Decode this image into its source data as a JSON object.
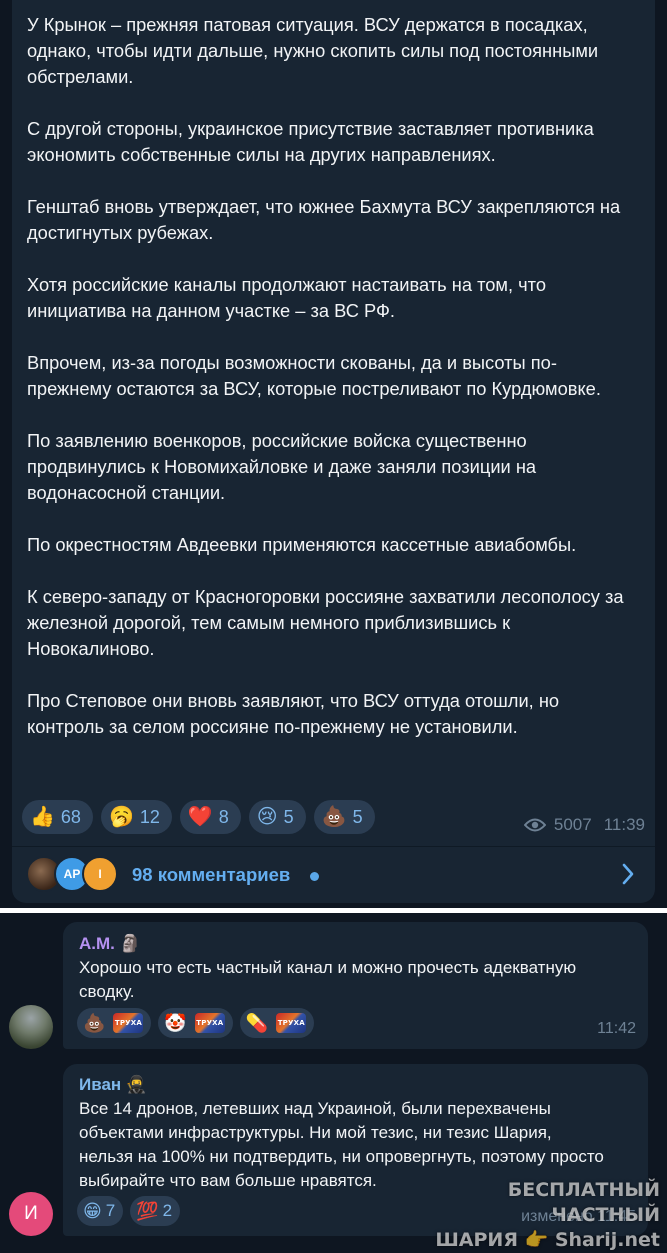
{
  "post": {
    "paragraphs": [
      "У Крынок – прежняя патовая ситуация. ВСУ держатся в посадках, однако, чтобы идти дальше, нужно скопить силы под постоянными обстрелами.",
      "С другой стороны, украинское присутствие заставляет противника экономить собственные силы на других направлениях.",
      "Генштаб вновь утверждает, что южнее Бахмута ВСУ закрепляются на достигнутых рубежах.",
      "Хотя российские каналы продолжают настаивать на том, что инициатива на данном участке – за ВС РФ.",
      "Впрочем, из-за погоды возможности скованы, да и высоты по-прежнему остаются за ВСУ, которые постреливают по Курдюмовке.",
      "По заявлению военкоров, российские войска существенно продвинулись к Новомихайловке и даже заняли позиции на водонасосной станции.",
      "По окрестностям Авдеевки применяются кассетные авиабомбы.",
      "К северо-западу от Красногоровки россияне захватили лесополосу за железной дорогой, тем самым немного приблизившись к Новокалиново.",
      "Про Степовое они вновь заявляют, что ВСУ оттуда отошли, но контроль за селом россияне по-прежнему не установили."
    ],
    "reactions": [
      {
        "emoji": "👍",
        "count": "68",
        "icon": "thumbs-up-icon"
      },
      {
        "emoji": "🥱",
        "count": "12",
        "icon": "yawning-face-icon"
      },
      {
        "emoji": "❤️",
        "count": "8",
        "icon": "heart-icon"
      },
      {
        "emoji": "😢",
        "count": "5",
        "icon": "crying-face-icon"
      },
      {
        "emoji": "💩",
        "count": "5",
        "icon": "pile-of-poo-icon"
      }
    ],
    "views": "5007",
    "time": "11:39"
  },
  "comments_bar": {
    "label": "98 комментариев",
    "avatars": [
      "",
      "AP",
      "I"
    ],
    "avatar_colors": [
      "#5a4030",
      "#3f9be6",
      "#f0a030"
    ]
  },
  "comments": [
    {
      "author": "А.М. 🗿",
      "author_color": "#b591f0",
      "text": "Хорошо что есть частный канал и можно прочесть адекватную сводку.",
      "time": "11:42",
      "reactions": [
        {
          "emoji": "💩",
          "badge": "ТРУХА",
          "icon": "pile-of-poo-icon"
        },
        {
          "emoji": "🤡",
          "badge": "ТРУХА",
          "icon": "clown-face-icon"
        },
        {
          "emoji": "💊",
          "badge": "ТРУХА",
          "icon": "pill-icon"
        }
      ]
    },
    {
      "author": "Иван 🥷",
      "author_color": "#7fb7ea",
      "avatar_letter": "И",
      "avatar_color": "#e44a7a",
      "text": "Все 14 дронов, летевших над Украиной, были перехвачены объектами инфраструктуры. Ни мой тезис, ни тезис Шария, нельзя на 100% ни подтвердить, ни опровергнуть, поэтому просто выбирайте что вам больше нравятся.",
      "time": "изменено 11:45",
      "reactions": [
        {
          "emoji": "😁",
          "count": "7",
          "icon": "grinning-face-icon"
        },
        {
          "emoji": "💯",
          "count": "2",
          "icon": "hundred-points-icon"
        }
      ]
    }
  ],
  "watermark": {
    "line1": "БЕСПЛАТНЫЙ ЧАСТНЫЙ",
    "line2": "ШАРИЯ 👉 Sharij.net"
  }
}
